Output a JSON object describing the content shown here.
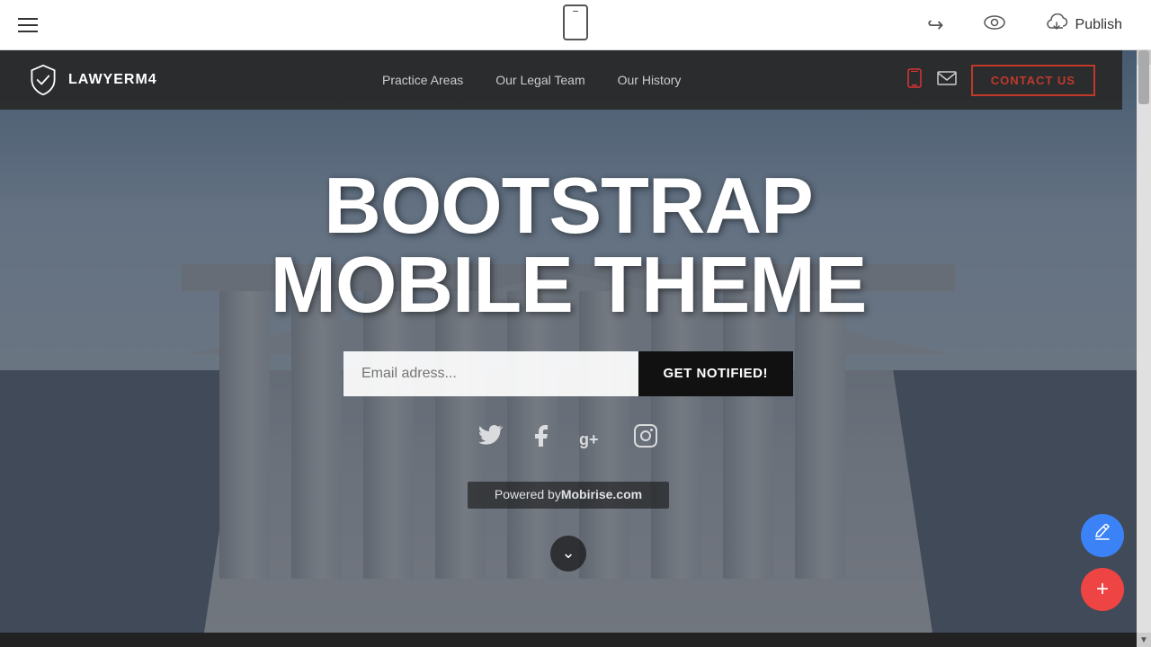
{
  "editor": {
    "publish_label": "Publish",
    "hamburger_label": "Menu",
    "undo_symbol": "↩",
    "eye_symbol": "👁",
    "cloud_symbol": "☁"
  },
  "nav": {
    "logo_text": "LAWYERM4",
    "links": [
      {
        "label": "Practice Areas"
      },
      {
        "label": "Our Legal Team"
      },
      {
        "label": "Our History"
      }
    ],
    "contact_btn": "CONTACT US"
  },
  "hero": {
    "title_line1": "BOOTSTRAP",
    "title_line2": "MOBILE THEME",
    "email_placeholder": "Email adress...",
    "notify_btn": "GET NOTIFIED!",
    "powered_text": "Powered by",
    "powered_brand": "Mobirise.com"
  },
  "social": {
    "twitter_symbol": "𝕏",
    "facebook_symbol": "f",
    "googleplus_symbol": "g+",
    "instagram_symbol": "📷"
  },
  "fab": {
    "edit_symbol": "✎",
    "add_symbol": "+"
  }
}
